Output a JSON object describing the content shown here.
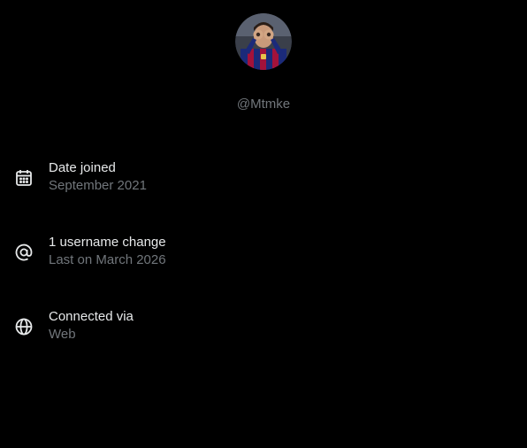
{
  "colors": {
    "background": "#000000",
    "primary_text": "#e7e9ea",
    "secondary_text": "#71767b"
  },
  "profile": {
    "handle": "@Mtmke",
    "avatar_icon": "profile-photo"
  },
  "about": {
    "items": [
      {
        "icon": "calendar-icon",
        "title": "Date joined",
        "subtitle": "September 2021"
      },
      {
        "icon": "at-sign-icon",
        "title": "1 username change",
        "subtitle": "Last on March 2026"
      },
      {
        "icon": "globe-icon",
        "title": "Connected via",
        "subtitle": "Web"
      }
    ]
  }
}
